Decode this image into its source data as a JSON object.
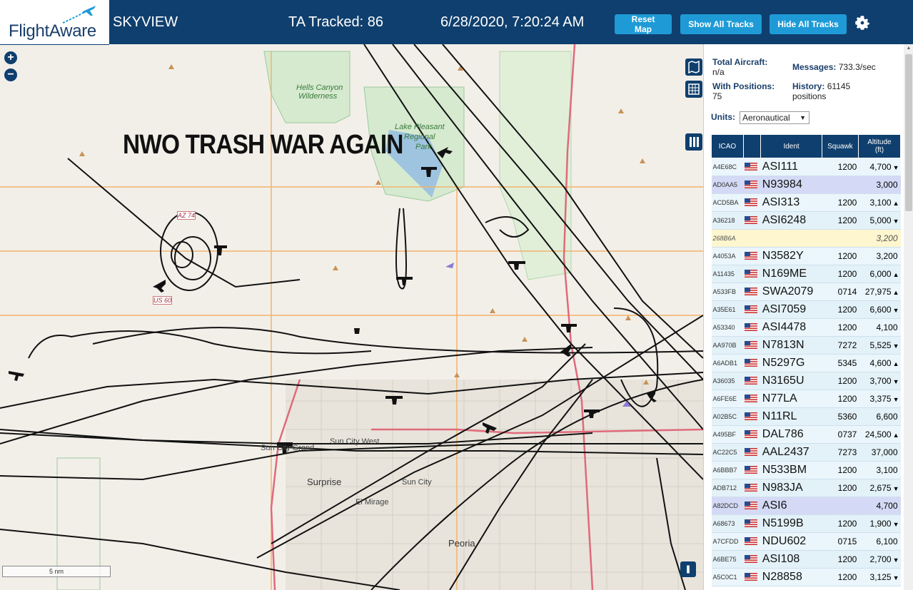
{
  "header": {
    "logo": "FlightAware",
    "app_title": "SKYVIEW",
    "ta_tracked": "TA Tracked: 86",
    "datetime": "6/28/2020, 7:20:24 AM",
    "buttons": {
      "reset": "Reset Map",
      "show_all": "Show All Tracks",
      "hide_all": "Hide All Tracks"
    },
    "accent_color": "#1e9bd7",
    "bar_color": "#0f3f6e"
  },
  "map": {
    "zoom_in": "+",
    "zoom_out": "−",
    "overlay_text": "NWO TRASH WAR AGAIN",
    "scale": "5 nm",
    "labels": {
      "hells_canyon": "Hells Canyon",
      "wilderness": "Wilderness",
      "lake1": "Lake Pleasant",
      "lake2": "Regional",
      "lake3": "Park",
      "surprise": "Surprise",
      "sun_city_west": "Sun City West",
      "sun_city": "Sun City",
      "el_mirage": "El Mirage",
      "peoria": "Peoria",
      "sun_city_grand": "Sun City Grand",
      "us60": "US 60",
      "az74": "AZ 74"
    }
  },
  "sidebar": {
    "total_aircraft_label": "Total Aircraft:",
    "total_aircraft_value": "n/a",
    "messages_label": "Messages:",
    "messages_value": "733.3/sec",
    "with_positions_label": "With Positions:",
    "with_positions_value": "75",
    "history_label": "History:",
    "history_value": "61145",
    "history_unit": "positions",
    "units_label": "Units:",
    "units_value": "Aeronautical",
    "columns": {
      "icao": "ICAO",
      "ident": "Ident",
      "squawk": "Squawk",
      "altitude": "Altitude",
      "altitude_unit": "(ft)"
    }
  },
  "aircraft": [
    {
      "icao": "A4E68C",
      "flag": true,
      "ident": "ASI111",
      "squawk": "1200",
      "alt": "4,700",
      "trend": "▼",
      "style": "even"
    },
    {
      "icao": "AD0AA5",
      "flag": true,
      "ident": "N93984",
      "squawk": "",
      "alt": "3,000",
      "trend": "",
      "style": "sel"
    },
    {
      "icao": "ACD5BA",
      "flag": true,
      "ident": "ASI313",
      "squawk": "1200",
      "alt": "3,100",
      "trend": "▲",
      "style": "even"
    },
    {
      "icao": "A36218",
      "flag": true,
      "ident": "ASI6248",
      "squawk": "1200",
      "alt": "5,000",
      "trend": "▼",
      "style": "odd"
    },
    {
      "icao": "268B6A",
      "flag": false,
      "ident": "",
      "squawk": "",
      "alt": "3,200",
      "trend": "",
      "style": "nopos"
    },
    {
      "icao": "A4053A",
      "flag": true,
      "ident": "N3582Y",
      "squawk": "1200",
      "alt": "3,200",
      "trend": "",
      "style": "even"
    },
    {
      "icao": "A11435",
      "flag": true,
      "ident": "N169ME",
      "squawk": "1200",
      "alt": "6,000",
      "trend": "▲",
      "style": "odd"
    },
    {
      "icao": "A533FB",
      "flag": true,
      "ident": "SWA2079",
      "squawk": "0714",
      "alt": "27,975",
      "trend": "▲",
      "style": "even"
    },
    {
      "icao": "A35E61",
      "flag": true,
      "ident": "ASI7059",
      "squawk": "1200",
      "alt": "6,600",
      "trend": "▼",
      "style": "odd"
    },
    {
      "icao": "A53340",
      "flag": true,
      "ident": "ASI4478",
      "squawk": "1200",
      "alt": "4,100",
      "trend": "",
      "style": "even"
    },
    {
      "icao": "AA970B",
      "flag": true,
      "ident": "N7813N",
      "squawk": "7272",
      "alt": "5,525",
      "trend": "▼",
      "style": "odd"
    },
    {
      "icao": "A6ADB1",
      "flag": true,
      "ident": "N5297G",
      "squawk": "5345",
      "alt": "4,600",
      "trend": "▲",
      "style": "even"
    },
    {
      "icao": "A36035",
      "flag": true,
      "ident": "N3165U",
      "squawk": "1200",
      "alt": "3,700",
      "trend": "▼",
      "style": "odd"
    },
    {
      "icao": "A6FE6E",
      "flag": true,
      "ident": "N77LA",
      "squawk": "1200",
      "alt": "3,375",
      "trend": "▼",
      "style": "even"
    },
    {
      "icao": "A02B5C",
      "flag": true,
      "ident": "N11RL",
      "squawk": "5360",
      "alt": "6,600",
      "trend": "",
      "style": "odd"
    },
    {
      "icao": "A495BF",
      "flag": true,
      "ident": "DAL786",
      "squawk": "0737",
      "alt": "24,500",
      "trend": "▲",
      "style": "even"
    },
    {
      "icao": "AC22C5",
      "flag": true,
      "ident": "AAL2437",
      "squawk": "7273",
      "alt": "37,000",
      "trend": "",
      "style": "odd"
    },
    {
      "icao": "A6BBB7",
      "flag": true,
      "ident": "N533BM",
      "squawk": "1200",
      "alt": "3,100",
      "trend": "",
      "style": "even"
    },
    {
      "icao": "ADB712",
      "flag": true,
      "ident": "N983JA",
      "squawk": "1200",
      "alt": "2,675",
      "trend": "▼",
      "style": "odd"
    },
    {
      "icao": "A82DCD",
      "flag": true,
      "ident": "ASI6",
      "squawk": "",
      "alt": "4,700",
      "trend": "",
      "style": "sel"
    },
    {
      "icao": "A68673",
      "flag": true,
      "ident": "N5199B",
      "squawk": "1200",
      "alt": "1,900",
      "trend": "▼",
      "style": "odd"
    },
    {
      "icao": "A7CFDD",
      "flag": true,
      "ident": "NDU602",
      "squawk": "0715",
      "alt": "6,100",
      "trend": "",
      "style": "even"
    },
    {
      "icao": "A6BE75",
      "flag": true,
      "ident": "ASI108",
      "squawk": "1200",
      "alt": "2,700",
      "trend": "▼",
      "style": "odd"
    },
    {
      "icao": "A5C0C1",
      "flag": true,
      "ident": "N28858",
      "squawk": "1200",
      "alt": "3,125",
      "trend": "▼",
      "style": "even"
    }
  ]
}
